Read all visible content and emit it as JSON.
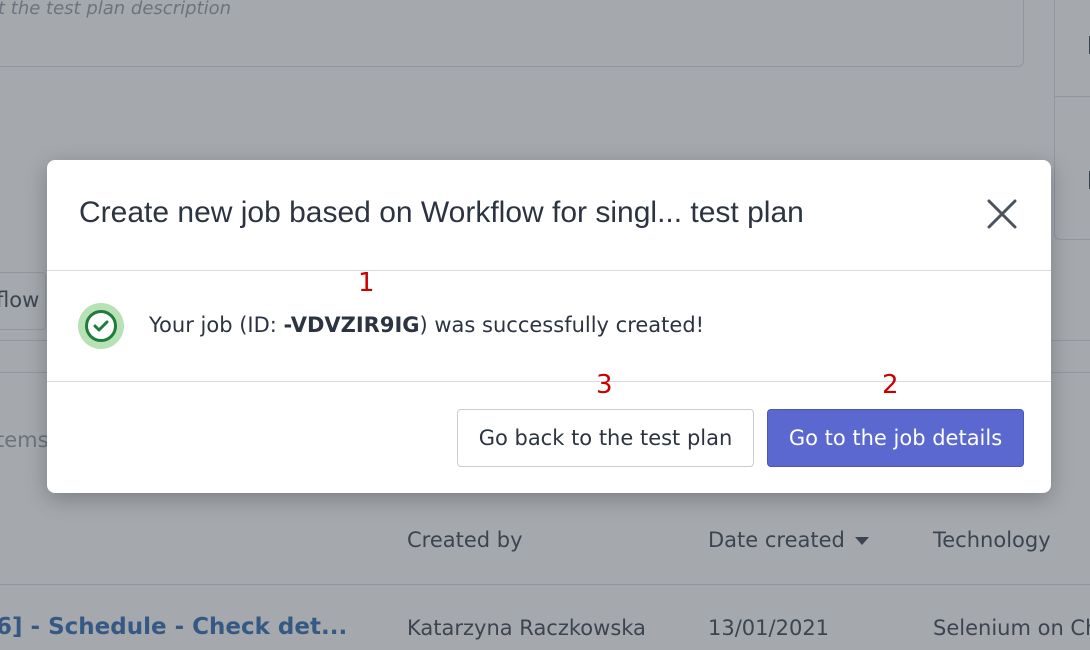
{
  "background": {
    "description_placeholder": "t the test plan description",
    "tab_partial": "flow",
    "search_partial": "tems",
    "table": {
      "columns": [
        "Created by",
        "Date created",
        "Technology"
      ],
      "row": {
        "name": "6] - Schedule - Check det...",
        "created_by": "Katarzyna Raczkowska",
        "date_created": "13/01/2021",
        "technology": "Selenium on Ch"
      }
    }
  },
  "modal": {
    "title": "Create new job based on Workflow for singl... test plan",
    "message_prefix": "Your job (ID: ",
    "job_id": "-VDVZIR9IG",
    "message_suffix": ") was successfully created!",
    "buttons": {
      "back": "Go back to the test plan",
      "details": "Go to the job details"
    }
  },
  "annotations": [
    "1",
    "2",
    "3"
  ],
  "colors": {
    "primary": "#5a68cf",
    "success": "#1e7d3a",
    "link": "#1f5ea8",
    "annotation": "#cc0000"
  }
}
